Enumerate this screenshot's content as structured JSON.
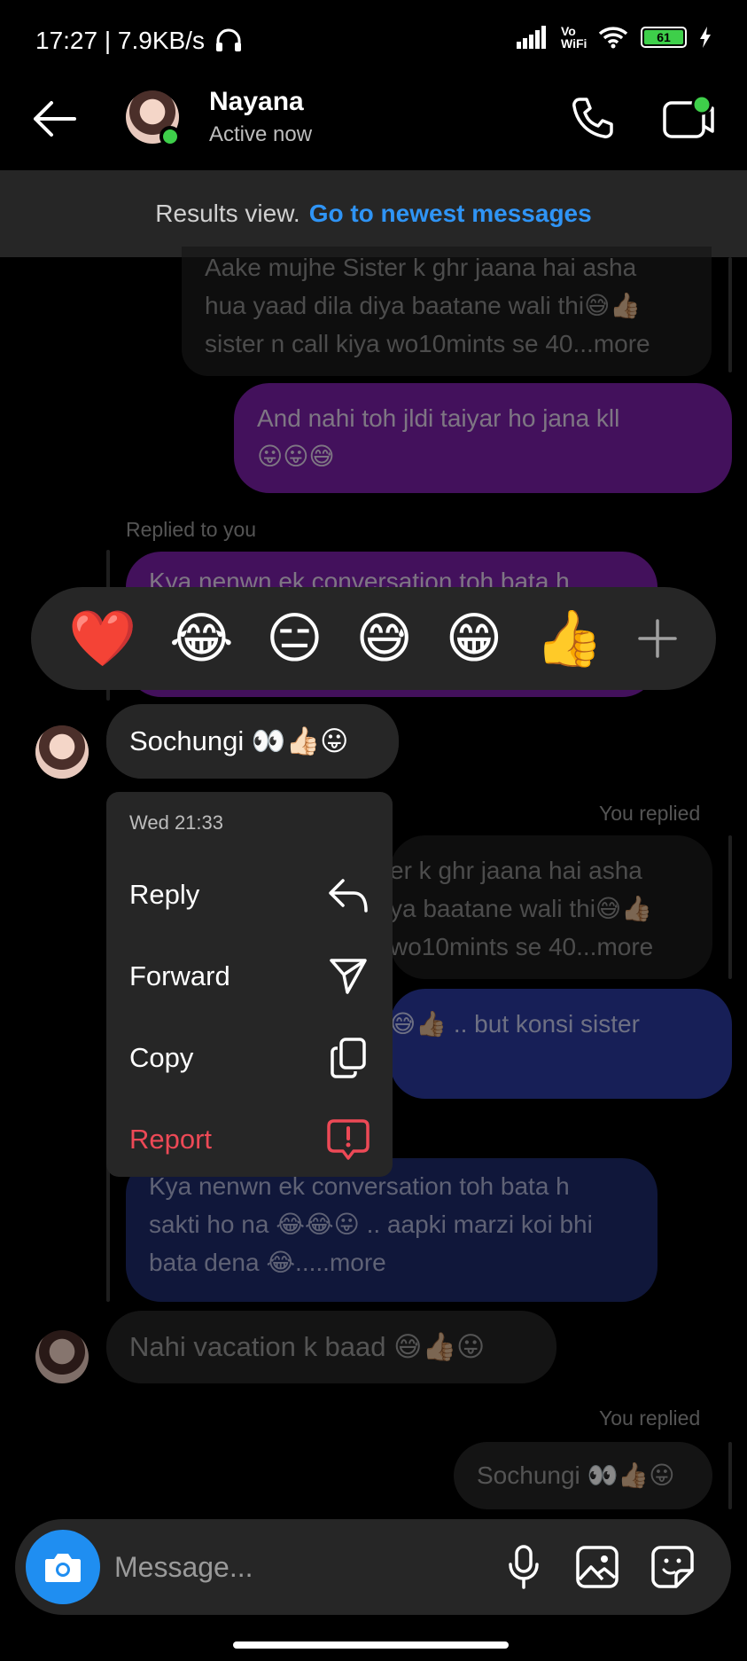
{
  "status_bar": {
    "time": "17:27 | 7.9KB/s",
    "network_label": "Vo WiFi",
    "battery": "61"
  },
  "header": {
    "name": "Nayana",
    "status": "Active now"
  },
  "banner": {
    "prefix": "Results view.",
    "link": "Go to newest messages"
  },
  "messages": {
    "m1_lines": [
      "Aake mujhe Sister k ghr jaana hai asha",
      "hua yaad dila diya baatane wali thi😅👍🏼",
      "sister n call kiya wo10mints se 40...more"
    ],
    "m2_lines": [
      "And nahi toh jldi taiyar ho jana kll",
      "😛😛😅"
    ],
    "replied_label": "Replied to you",
    "m3_partial": "Kya nenwn ek conversation toh bata h",
    "m4": "Sochungi 👀👍🏻😛",
    "you_replied_1": "You replied",
    "m5_lines": [
      "er k ghr jaana hai asha",
      "ya baatane wali thi😅👍🏼",
      "wo10mints se 40...more"
    ],
    "m6": "😅👍🏼 .. but konsi sister",
    "m7_lines": [
      "Kya nenwn ek conversation toh bata h",
      "sakti ho na 😂😂😛 .. aapki marzi koi bhi",
      "bata dena 😂.....more"
    ],
    "m8": "Nahi vacation k baad 😅👍🏼😛",
    "you_replied_2": "You replied",
    "m9": "Sochungi 👀👍🏼😛"
  },
  "reactions": [
    "❤️",
    "😂",
    "😑",
    "😅",
    "😁",
    "👍"
  ],
  "context_menu": {
    "timestamp": "Wed 21:33",
    "reply": "Reply",
    "forward": "Forward",
    "copy": "Copy",
    "report": "Report"
  },
  "composer": {
    "placeholder": "Message..."
  },
  "colors": {
    "accent_blue": "#1f8ef1",
    "report_red": "#ed4956",
    "online_green": "#3ecf4a"
  },
  "icons": [
    "back-arrow-icon",
    "phone-icon",
    "video-call-icon",
    "reply-icon",
    "send-icon",
    "copy-icon",
    "report-icon",
    "camera-icon",
    "microphone-icon",
    "gallery-icon",
    "sticker-icon",
    "plus-icon"
  ]
}
